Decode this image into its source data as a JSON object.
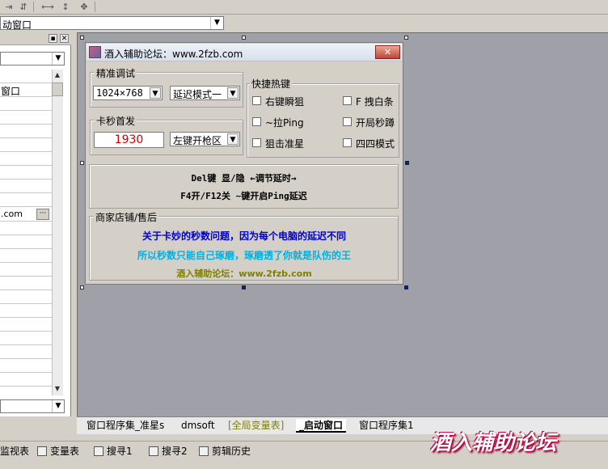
{
  "top_combo": {
    "value": "动窗口"
  },
  "left_panel": {
    "rows": [
      "窗口",
      ".com"
    ]
  },
  "form": {
    "title": "酒入辅助论坛：www.2fzb.com",
    "close_label": "✕",
    "precision_group": {
      "title": "精准调试",
      "resolution": "1024×768",
      "delay_mode": "延迟模式一"
    },
    "hotkey_group": {
      "title": "快捷热键",
      "items": [
        "右键瞬狙",
        "F 拽白条",
        "~拉Ping",
        "开局秒蹲",
        "狙击准星",
        "四四模式"
      ]
    },
    "fire_group": {
      "title": "卡秒首发",
      "time_value": "1930",
      "fire_key": "左键开枪区"
    },
    "info": {
      "line1": "Del键 显/隐 ←调节延时→",
      "line2": "F4开/F12关 ~键开启Ping延迟"
    },
    "shop": {
      "title": "商家店铺/售后",
      "line1": "关于卡妙的秒数问题，因为每个电脑的延迟不同",
      "line2": "所以秒数只能自己琢磨，琢磨透了你就是队伤的王",
      "line3": "酒入辅助论坛：www.2fzb.com",
      "colors": {
        "line1": "#0000cc",
        "line2": "#00b0e0",
        "line3": "#808000"
      }
    }
  },
  "tabs": [
    "窗口程序集_准星s",
    "dmsoft",
    "[全局变量表]",
    "_启动窗口",
    "窗口程序集1"
  ],
  "statusbar": {
    "items": [
      "监视表",
      "变量表",
      "搜寻1",
      "搜寻2",
      "剪辑历史"
    ]
  },
  "watermark": "酒入辅助论坛"
}
